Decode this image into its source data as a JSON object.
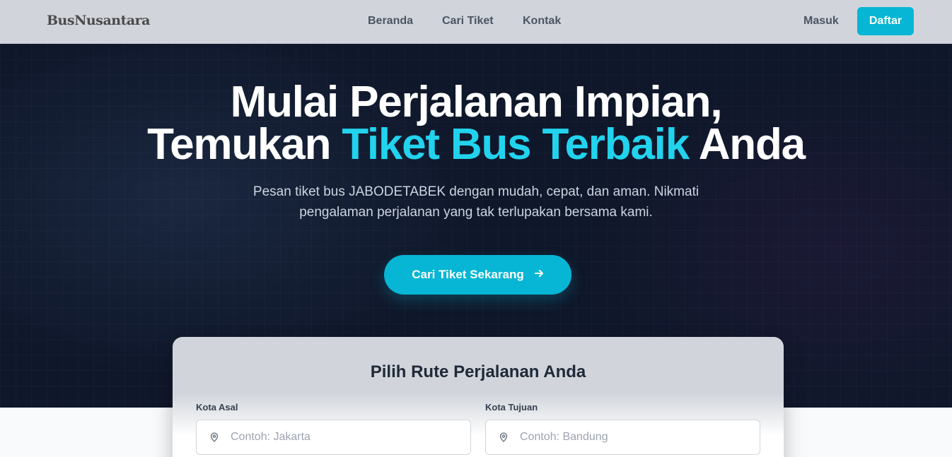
{
  "header": {
    "logo": "BusNusantara",
    "nav": [
      "Beranda",
      "Cari Tiket",
      "Kontak"
    ],
    "login": "Masuk",
    "register": "Daftar"
  },
  "hero": {
    "headline_line1": "Mulai Perjalanan Impian,",
    "headline_line2_start": "Temukan ",
    "headline_line2_accent": "Tiket Bus Terbaik",
    "headline_line2_end": " Anda",
    "subtitle_line1": "Pesan tiket bus JABODETABEK dengan mudah, cepat, dan aman. Nikmati",
    "subtitle_line2": "pengalaman perjalanan yang tak terlupakan bersama kami.",
    "cta_label": "Cari Tiket Sekarang",
    "cta_icon": "arrow-right-icon"
  },
  "route_form": {
    "title": "Pilih Rute Perjalanan Anda",
    "origin_label": "Kota Asal",
    "origin_placeholder": "Contoh: Jakarta",
    "destination_label": "Kota Tujuan",
    "destination_placeholder": "Contoh: Bandung",
    "field_icon": "map-pin-icon"
  },
  "colors": {
    "accent": "#06b6d4",
    "accent_text": "#22d3ee",
    "hero_bg": "#0f172a",
    "header_bg": "#d1d5db"
  }
}
